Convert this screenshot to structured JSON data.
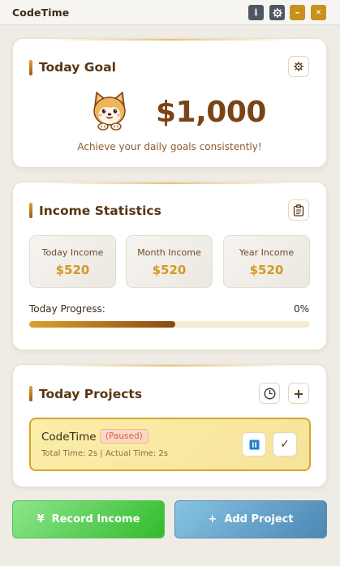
{
  "app": {
    "title": "CodeTime",
    "titlebar_buttons": {
      "info": "i",
      "settings_icon": "gear-icon",
      "minimize": "–",
      "close": "✕"
    }
  },
  "goal": {
    "title": "Today Goal",
    "amount": "$1,000",
    "caption": "Achieve your daily goals consistently!",
    "settings_icon": "gear-icon",
    "mascot_icon": "dog-mascot-icon"
  },
  "income": {
    "title": "Income Statistics",
    "clipboard_icon": "clipboard-icon",
    "stats": [
      {
        "label": "Today Income",
        "value": "$520"
      },
      {
        "label": "Month Income",
        "value": "$520"
      },
      {
        "label": "Year Income",
        "value": "$520"
      }
    ],
    "progress_label": "Today Progress:",
    "progress_text": "0%",
    "progress_bar_fill_fraction": 0.52
  },
  "projects": {
    "title": "Today Projects",
    "history_icon": "clock-icon",
    "add_label": "+",
    "items": [
      {
        "name": "CodeTime",
        "status": "(Paused)",
        "meta": "Total Time: 2s | Actual Time: 2s",
        "pause_icon": "pause-icon",
        "complete_label": "✓"
      }
    ]
  },
  "actions": {
    "record_symbol": "¥",
    "record_label": "Record Income",
    "add_symbol": "+",
    "add_label": "Add Project"
  },
  "colors": {
    "accent_gold": "#d19a24",
    "title_brown": "#5a3614",
    "record_green": "#33bb2c",
    "add_blue": "#4d87b4",
    "paused_red": "#d85a5a"
  }
}
